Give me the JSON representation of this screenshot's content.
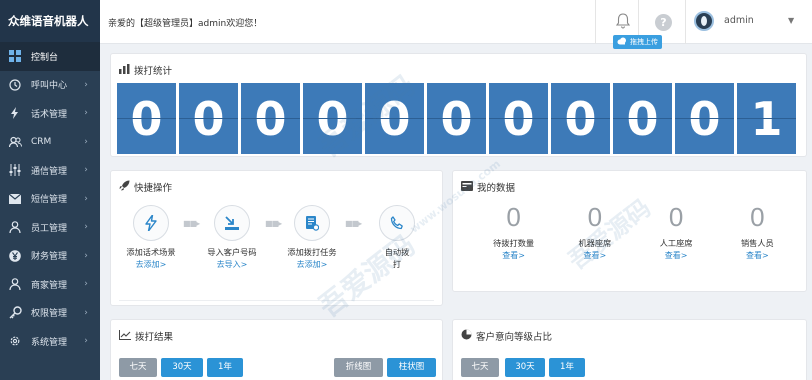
{
  "brand": "众维语音机器人",
  "sidebar": {
    "items": [
      {
        "label": "控制台",
        "icon": "dashboard-icon",
        "active": true
      },
      {
        "label": "呼叫中心",
        "icon": "clock-icon"
      },
      {
        "label": "话术管理",
        "icon": "bolt-icon"
      },
      {
        "label": "CRM",
        "icon": "users-icon"
      },
      {
        "label": "通信管理",
        "icon": "sliders-icon"
      },
      {
        "label": "短信管理",
        "icon": "envelope-icon"
      },
      {
        "label": "员工管理",
        "icon": "user-icon"
      },
      {
        "label": "财务管理",
        "icon": "yen-icon"
      },
      {
        "label": "商家管理",
        "icon": "user-icon"
      },
      {
        "label": "权限管理",
        "icon": "key-icon"
      },
      {
        "label": "系统管理",
        "icon": "gear-icon"
      }
    ]
  },
  "header": {
    "welcome": "亲爱的【超级管理员】admin欢迎您！",
    "username": "admin",
    "upload_badge": "拖拽上传"
  },
  "stats": {
    "title": "拨打统计",
    "digits": [
      "0",
      "0",
      "0",
      "0",
      "0",
      "0",
      "0",
      "0",
      "0",
      "0",
      "1"
    ]
  },
  "quick": {
    "title": "快捷操作",
    "steps": [
      {
        "label": "添加话术场景",
        "link": "去添加>",
        "icon": "bolt-icon"
      },
      {
        "label": "导入客户号码",
        "link": "去导入>",
        "icon": "import-icon"
      },
      {
        "label": "添加拨打任务",
        "link": "去添加>",
        "icon": "document-icon"
      },
      {
        "label": "自动拨",
        "label2": "打",
        "icon": "phone-icon"
      }
    ],
    "arrows": [
      "■■▸",
      "■■▸",
      "■■▸"
    ]
  },
  "mydata": {
    "title": "我的数据",
    "items": [
      {
        "value": "0",
        "label": "待拨打数量",
        "link": "查看>"
      },
      {
        "value": "0",
        "label": "机器座席",
        "link": "查看>"
      },
      {
        "value": "0",
        "label": "人工座席",
        "link": "查看>"
      },
      {
        "value": "0",
        "label": "销售人员",
        "link": "查看>"
      }
    ]
  },
  "results": {
    "title": "拨打结果",
    "ranges": [
      "七天",
      "30天",
      "1年"
    ],
    "views": [
      "折线图",
      "柱状图"
    ]
  },
  "intent": {
    "title": "客户意向等级占比",
    "ranges": [
      "七天",
      "30天",
      "1年"
    ]
  },
  "watermarks": [
    "吾爱源码",
    "www.wosuoa.com"
  ],
  "colors": {
    "sidebar": "#2a3f54",
    "digit": "#3d7ab8",
    "link": "#2b86c9",
    "button_blue": "#2b93d6",
    "button_grey": "#8e9aa6"
  }
}
